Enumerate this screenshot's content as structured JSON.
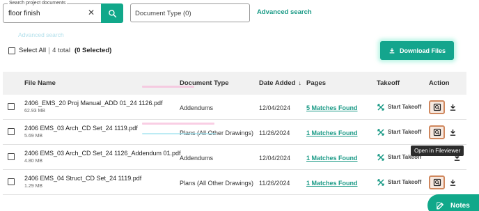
{
  "search": {
    "legend": "Search project documents",
    "value": "floor finish",
    "clear_icon": "close-icon",
    "button_icon": "search-icon"
  },
  "filter": {
    "doc_type_label": "Document Type (0)",
    "advanced_search": "Advanced search"
  },
  "ghost_link": "Advanced search",
  "selection": {
    "select_all": "Select All",
    "total": "4 total",
    "selected": "(0 Selected)"
  },
  "download_button": "Download Files",
  "table": {
    "headers": {
      "file_name": "File Name",
      "document_type": "Document Type",
      "date_added": "Date Added",
      "pages": "Pages",
      "takeoff": "Takeoff",
      "action": "Action"
    },
    "rows": [
      {
        "name": "2406_EMS_20 Proj Manual_ADD 01_24 1126.pdf",
        "size": "62.93 MB",
        "type": "Addendums",
        "date": "12/04/2024",
        "pages": "5 Matches Found",
        "takeoff": "Start Takeoff"
      },
      {
        "name": "2406 EMS_03 Arch_CD Set_24 1119.pdf",
        "size": "5.69 MB",
        "type": "Plans (All Other Drawings)",
        "date": "11/26/2024",
        "pages": "1 Matches Found",
        "takeoff": "Start Takeoff"
      },
      {
        "name": "2406 EMS_03 Arch_CD Set_24 1126_Addendum 01.pdf",
        "size": "4.80 MB",
        "type": "Addendums",
        "date": "12/04/2024",
        "pages": "1 Matches Found",
        "takeoff": "Start Takeoff"
      },
      {
        "name": "2406 EMS_04 Struct_CD Set_24 1119.pdf",
        "size": "1.29 MB",
        "type": "Plans (All Other Drawings)",
        "date": "11/26/2024",
        "pages": "1 Matches Found",
        "takeoff": "Start Takeoff"
      }
    ]
  },
  "tooltip": "Open in Fileviewer",
  "notes_button": "Notes",
  "colors": {
    "accent": "#11a88a",
    "link": "#1a9a86",
    "view_border": "#d0885e"
  }
}
